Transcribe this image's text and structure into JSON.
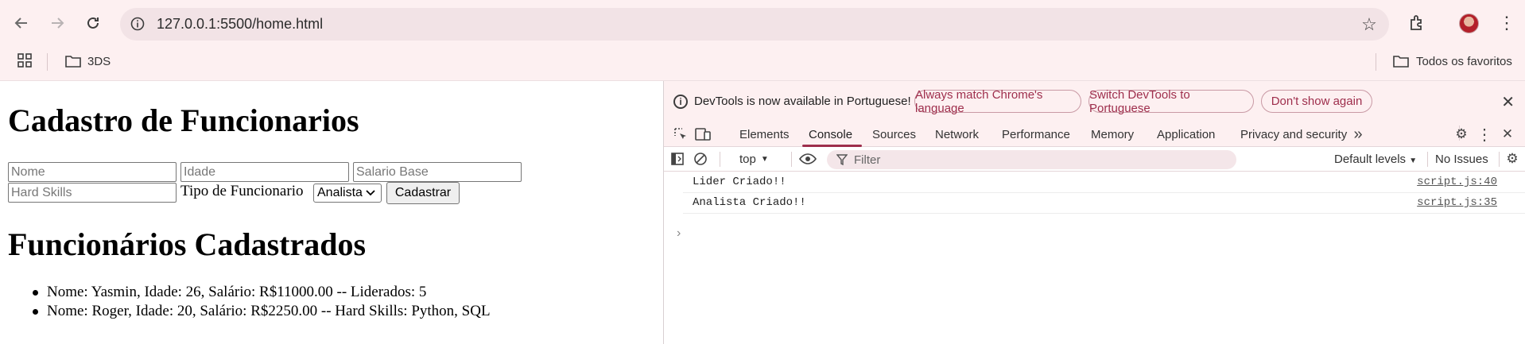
{
  "browser": {
    "url": "127.0.0.1:5500/home.html",
    "bookmarks": {
      "folder": "3DS",
      "all_bookmarks": "Todos os favoritos"
    }
  },
  "page": {
    "title": "Cadastro de Funcionarios",
    "form": {
      "nome_placeholder": "Nome",
      "idade_placeholder": "Idade",
      "salario_placeholder": "Salario Base",
      "hardskills_placeholder": "Hard Skills",
      "tipo_label": "Tipo de Funcionario",
      "tipo_selected": "Analista",
      "submit_label": "Cadastrar"
    },
    "list_title": "Funcionários Cadastrados",
    "employees": [
      "Nome: Yasmin, Idade: 26, Salário: R$11000.00 -- Liderados: 5",
      "Nome: Roger, Idade: 20, Salário: R$2250.00 -- Hard Skills: Python, SQL"
    ]
  },
  "devtools": {
    "infobar": {
      "message": "DevTools is now available in Portuguese!",
      "match_button": "Always match Chrome's language",
      "switch_button": "Switch DevTools to Portuguese",
      "dont_show_button": "Don't show again"
    },
    "tabs": [
      "Elements",
      "Console",
      "Sources",
      "Network",
      "Performance",
      "Memory",
      "Application",
      "Privacy and security"
    ],
    "active_tab": "Console",
    "console": {
      "context": "top",
      "filter_placeholder": "Filter",
      "levels": "Default levels",
      "issues": "No Issues",
      "logs": [
        {
          "message": "Lider Criado!!",
          "source": "script.js:40"
        },
        {
          "message": "Analista Criado!!",
          "source": "script.js:35"
        }
      ]
    },
    "accent_color": "#9e2e4c"
  }
}
